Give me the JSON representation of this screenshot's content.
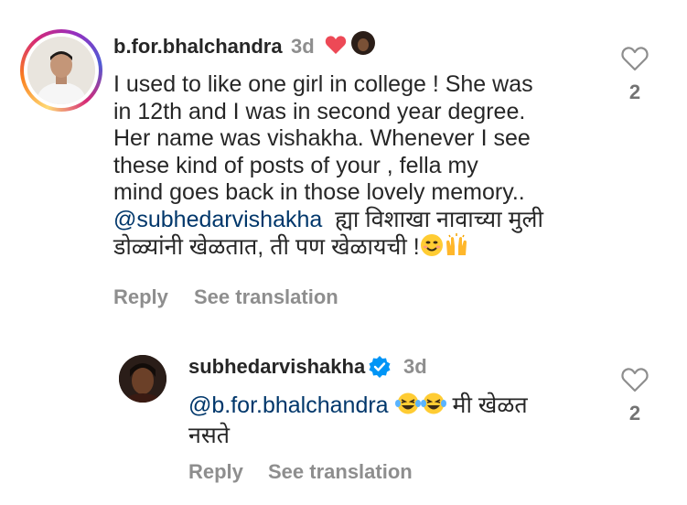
{
  "comment": {
    "username": "b.for.bhalchandra",
    "time": "3d",
    "lines": [
      "I used to like one girl in college ! She was",
      "in 12th and I was in second year degree.",
      "Her name was vishakha. Whenever I see",
      "these kind of posts of your , fella my",
      "mind goes back in those lovely memory.."
    ],
    "mention": "@subhedarvishakha",
    "marathi_line1": "ह्या विशाखा नावाच्या मुली",
    "marathi_line2": "डोळ्यांनी खेळतात, ती पण खेळायची !",
    "reply_label": "Reply",
    "translate_label": "See translation",
    "like_count": "2"
  },
  "reply": {
    "username": "subhedarvishakha",
    "time": "3d",
    "mention": "@b.for.bhalchandra",
    "text_line1": "मी खेळत",
    "text_line2": "नसते",
    "reply_label": "Reply",
    "translate_label": "See translation",
    "like_count": "2"
  },
  "colors": {
    "verified": "#0095f6",
    "heart": "#ed4956",
    "mention": "#00376b",
    "secondary": "#8e8e8e"
  }
}
